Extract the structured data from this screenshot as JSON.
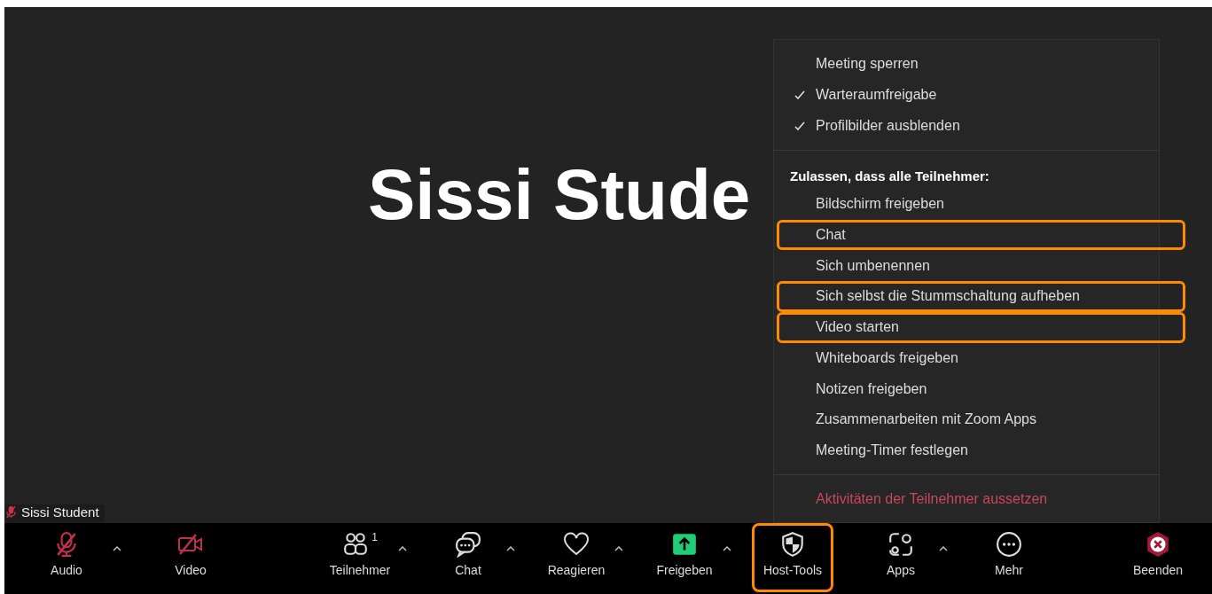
{
  "video_tile": {
    "name": "Sissi Stude",
    "name_tag": "Sissi Student",
    "muted": true
  },
  "menu": {
    "sections": [
      {
        "items": [
          {
            "kind": "item",
            "label": "Meeting sperren",
            "checked": false,
            "highlighted": false
          },
          {
            "kind": "item",
            "label": "Warteraumfreigabe",
            "checked": true,
            "highlighted": false
          },
          {
            "kind": "item",
            "label": "Profilbilder ausblenden",
            "checked": true,
            "highlighted": false
          }
        ]
      },
      {
        "items": [
          {
            "kind": "header",
            "label": "Zulassen, dass alle Teilnehmer:"
          },
          {
            "kind": "item",
            "label": "Bildschirm freigeben",
            "checked": false,
            "highlighted": false
          },
          {
            "kind": "item",
            "label": "Chat",
            "checked": false,
            "highlighted": true
          },
          {
            "kind": "item",
            "label": "Sich umbenennen",
            "checked": false,
            "highlighted": false
          },
          {
            "kind": "item",
            "label": "Sich selbst die Stummschaltung aufheben",
            "checked": false,
            "highlighted": true
          },
          {
            "kind": "item",
            "label": "Video starten",
            "checked": false,
            "highlighted": true
          },
          {
            "kind": "item",
            "label": "Whiteboards freigeben",
            "checked": false,
            "highlighted": false
          },
          {
            "kind": "item",
            "label": "Notizen freigeben",
            "checked": false,
            "highlighted": false
          },
          {
            "kind": "item",
            "label": "Zusammenarbeiten mit Zoom Apps",
            "checked": false,
            "highlighted": false
          },
          {
            "kind": "item",
            "label": "Meeting-Timer festlegen",
            "checked": false,
            "highlighted": false
          }
        ]
      },
      {
        "items": [
          {
            "kind": "danger",
            "label": "Aktivitäten der Teilnehmer aussetzen"
          }
        ]
      }
    ]
  },
  "toolbar": {
    "left": [
      {
        "kind": "mic-muted",
        "label": "Audio",
        "caret": true,
        "highlighted": false
      },
      {
        "kind": "video-off",
        "label": "Video",
        "caret": false,
        "highlighted": false
      }
    ],
    "center": [
      {
        "kind": "participants",
        "label": "Teilnehmer",
        "count": "1",
        "caret": true,
        "highlighted": false
      },
      {
        "kind": "chat",
        "label": "Chat",
        "caret": true,
        "highlighted": false
      },
      {
        "kind": "heart",
        "label": "Reagieren",
        "caret": true,
        "highlighted": false
      },
      {
        "kind": "share",
        "label": "Freigeben",
        "caret": true,
        "highlighted": false
      },
      {
        "kind": "shield",
        "label": "Host-Tools",
        "caret": false,
        "highlighted": true
      },
      {
        "kind": "apps",
        "label": "Apps",
        "caret": true,
        "highlighted": false
      },
      {
        "kind": "more",
        "label": "Mehr",
        "caret": false,
        "highlighted": false
      }
    ],
    "right": [
      {
        "kind": "end",
        "label": "Beenden",
        "caret": false,
        "highlighted": false
      }
    ]
  }
}
